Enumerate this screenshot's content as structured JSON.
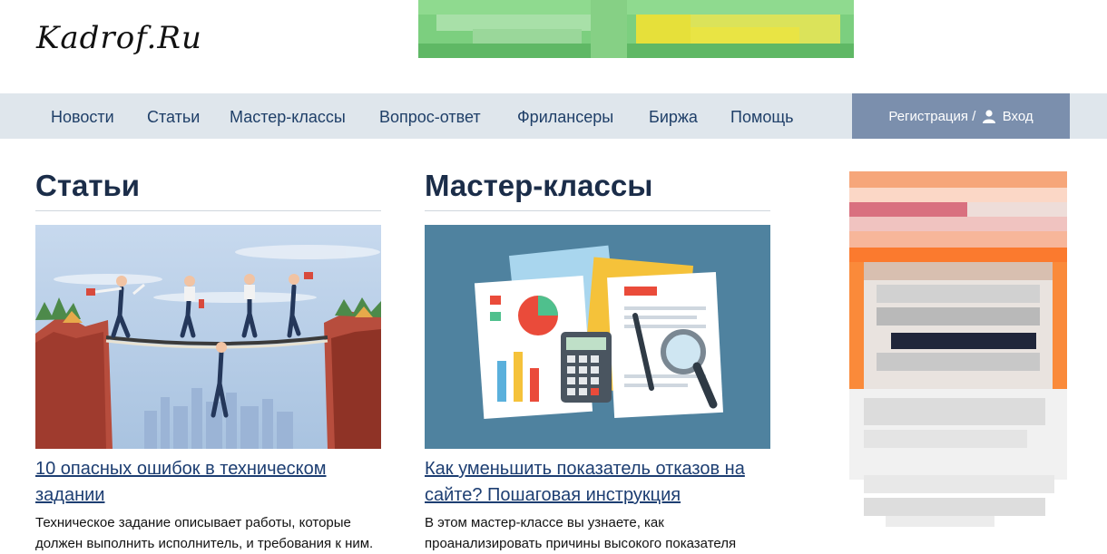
{
  "site": {
    "logo": "Kadrof.Ru"
  },
  "nav": {
    "items": [
      {
        "label": "Новости"
      },
      {
        "label": "Статьи"
      },
      {
        "label": "Мастер-классы"
      },
      {
        "label": "Вопрос-ответ"
      },
      {
        "label": "Фрилансеры"
      },
      {
        "label": "Биржа"
      },
      {
        "label": "Помощь"
      }
    ],
    "register": "Регистрация /",
    "login": "Вход"
  },
  "columns": [
    {
      "title": "Статьи",
      "article_title": "10 опасных ошибок в техническом задании",
      "article_excerpt": "Техническое задание описывает работы, которые должен выполнить исполнитель, и требования к ним."
    },
    {
      "title": "Мастер-классы",
      "article_title": "Как уменьшить показатель отказов на сайте? Пошаговая инструкция",
      "article_excerpt": "В этом мастер-классе вы узнаете, как проанализировать причины высокого показателя"
    }
  ],
  "colors": {
    "nav_bg": "#dfe6ec",
    "nav_text": "#1f3f68",
    "auth_bg": "#7b8fad",
    "heading": "#1b2d49",
    "link": "#1d3e72"
  }
}
